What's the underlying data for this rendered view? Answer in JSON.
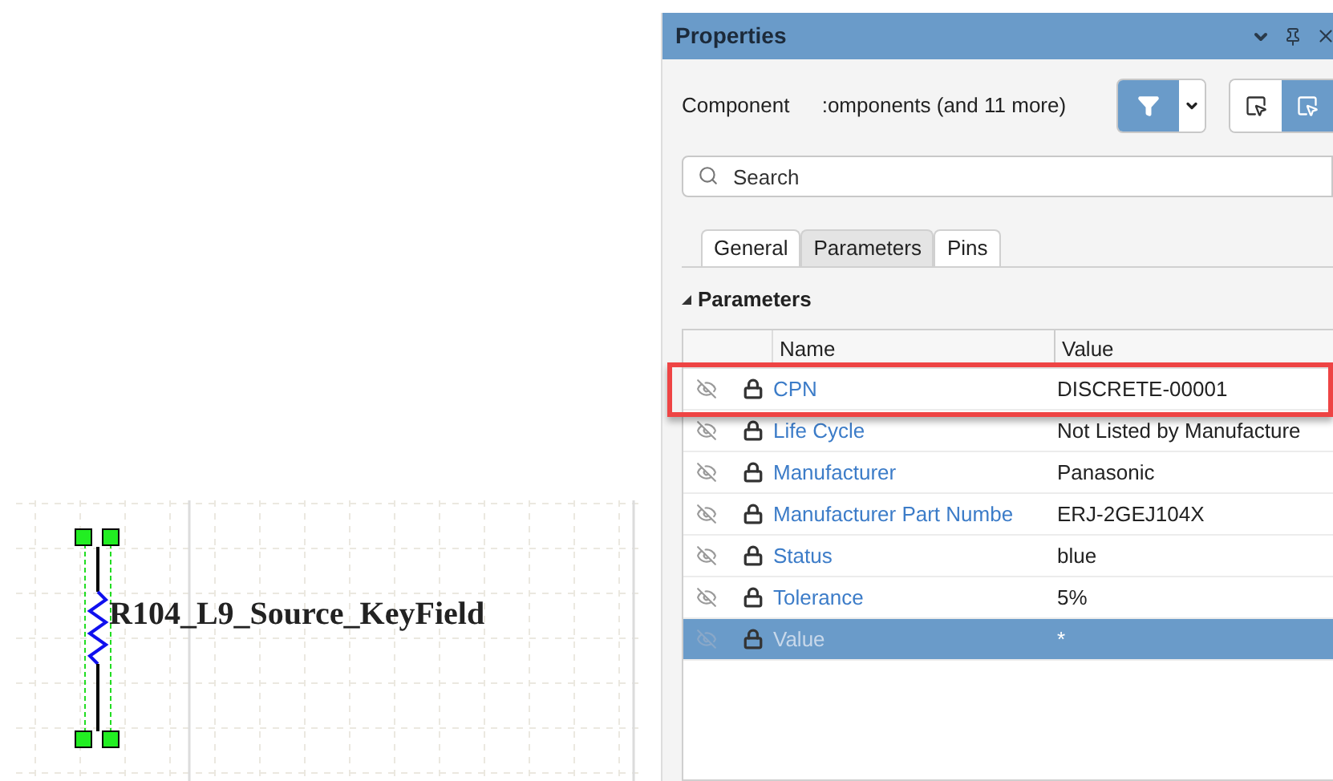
{
  "canvas": {
    "label": "R104_L9_Source_KeyField"
  },
  "panel": {
    "title": "Properties",
    "filter": {
      "label": "Component",
      "value": ":omponents (and 11 more)",
      "on": true
    },
    "select_modes": [
      {
        "selected": false
      },
      {
        "selected": true
      }
    ],
    "search": {
      "placeholder": "Search"
    },
    "tabs": [
      {
        "label": "General",
        "selected": false
      },
      {
        "label": "Parameters",
        "selected": true
      },
      {
        "label": "Pins",
        "selected": false
      }
    ],
    "section": {
      "title": "Parameters",
      "expanded": true
    },
    "table": {
      "columns": [
        "Name",
        "Value"
      ],
      "rows": [
        {
          "name": "CPN",
          "value": "DISCRETE-00001",
          "selected": false,
          "highlighted": true
        },
        {
          "name": "Life Cycle",
          "value": "Not Listed by Manufacture",
          "selected": false,
          "highlighted": false
        },
        {
          "name": "Manufacturer",
          "value": "Panasonic",
          "selected": false,
          "highlighted": false
        },
        {
          "name": "Manufacturer Part Numbe",
          "value": "ERJ-2GEJ104X",
          "selected": false,
          "highlighted": false
        },
        {
          "name": "Status",
          "value": "blue",
          "selected": false,
          "highlighted": false
        },
        {
          "name": "Tolerance",
          "value": "5%",
          "selected": false,
          "highlighted": false
        },
        {
          "name": "Value",
          "value": "*",
          "selected": true,
          "highlighted": false
        }
      ]
    }
  }
}
